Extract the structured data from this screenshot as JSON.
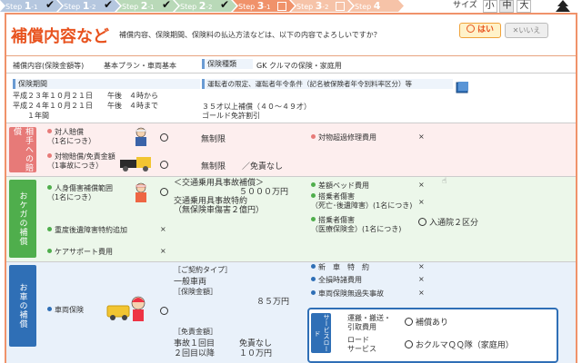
{
  "steps": [
    {
      "label": "Step",
      "num": "1",
      "sub": "-1",
      "done": true,
      "color": "#b5c7df"
    },
    {
      "label": "Step",
      "num": "1",
      "sub": "-2",
      "done": true,
      "color": "#b5c7df"
    },
    {
      "label": "Step",
      "num": "2",
      "sub": "-1",
      "done": true,
      "color": "#b9d9b8"
    },
    {
      "label": "Step",
      "num": "2",
      "sub": "-2",
      "done": true,
      "color": "#b9d9b8"
    },
    {
      "label": "Step",
      "num": "3",
      "sub": "-1",
      "done": false,
      "color": "#f0926a"
    },
    {
      "label": "Step",
      "num": "3",
      "sub": "-2",
      "done": false,
      "color": "#f6c3a8"
    },
    {
      "label": "Step",
      "num": "4",
      "sub": "",
      "done": false,
      "color": "#f6c3a8"
    }
  ],
  "size": {
    "label": "サイズ",
    "options": [
      "小",
      "中",
      "大"
    ],
    "selected": "中"
  },
  "header": {
    "title": "補償内容など",
    "question": "補償内容、保険期間、保険料の払込方法などは、以下の内容でよろしいですか？",
    "yes": "はい",
    "no": "いいえ"
  },
  "summary": {
    "plan_label": "補償内容(保険金額等)",
    "plan_value": "基本プラン・車両基本",
    "type_label": "保険種類",
    "type_value": "GK クルマの保険・家庭用",
    "period_label": "保険期間",
    "period_lines": [
      "平成２３年１０月２１日　　午後　４時から",
      "平成２４年１０月２１日　　午後　４時まで",
      "　　１年間"
    ],
    "driver_line": "運転者の限定、運転者年令条件（記名被保険者年令別料率区分）等",
    "driver_age": "３５才以上補償（４０〜４９才）",
    "gold": "ゴールド免許割引"
  },
  "sections": {
    "opponent": {
      "tab": "相手への賠償",
      "color": "#e77a78",
      "rows": [
        {
          "label": "対人賠償\n（1名につき）",
          "value": "無制限",
          "right_label": "対物超過修理費用",
          "right_value": "×"
        },
        {
          "label": "対物賠償/免責金額\n（1事故につき）",
          "value": "無制限　　／免責なし"
        }
      ]
    },
    "injury": {
      "tab": "おケガの補償",
      "color": "#4fae4c",
      "rows": [
        {
          "label": "人身傷害補償範囲\n（1名につき）",
          "value": "＜交通乗用具事故補償＞\n　　　　　　　　５０００万円\n交通乗用具事故特約\n（無保険車傷害２億円）"
        },
        {
          "label": "重度後遺障害特約追加",
          "value": "×"
        },
        {
          "label": "ケアサポート費用",
          "value": "×"
        }
      ],
      "right": [
        {
          "label": "差額ベッド費用",
          "value": "×"
        },
        {
          "label": "搭乗者傷害\n（死亡･後遺障害）(1名につき)",
          "value": "×"
        },
        {
          "label": "搭乗者傷害\n（医療保険金）(1名につき)",
          "value": "入通院２区分"
        }
      ]
    },
    "car": {
      "tab": "お車の補償",
      "color": "#2f6fb6",
      "label": "車両保険",
      "lines": [
        "［ご契約タイプ］",
        "一般車両",
        "［保険金額］",
        "８５万円",
        "［免責金額］",
        "事故１回目　　　免責なし",
        "２回目以降　　　１０万円"
      ],
      "right": [
        {
          "label": "新　車　特　約",
          "value": "×"
        },
        {
          "label": "全損時諸費用",
          "value": "×"
        },
        {
          "label": "車両保険無過失事故",
          "value": "×"
        }
      ],
      "service_tab": "サービスロード",
      "service": [
        {
          "label": "運搬・搬送・\n引取費用",
          "value": "補償あり"
        },
        {
          "label": "ロード\nサービス",
          "value": "おクルマＱＱ隊（家庭用）"
        }
      ]
    }
  }
}
